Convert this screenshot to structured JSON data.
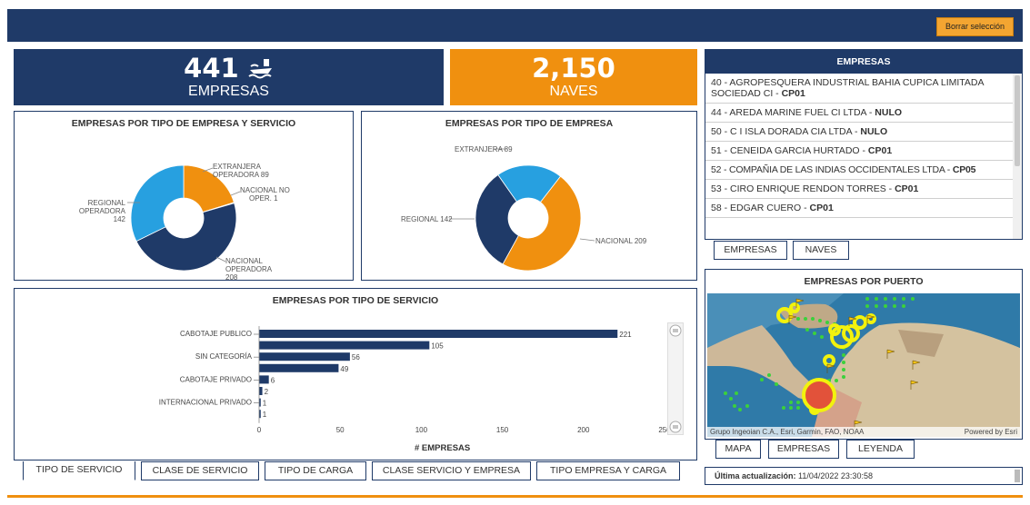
{
  "header": {
    "clear_selection_label": "Borrar selección"
  },
  "kpis": {
    "empresas": {
      "value": "441",
      "label": "EMPRESAS",
      "icon": "ship-icon"
    },
    "naves": {
      "value": "2,150",
      "label": "NAVES"
    }
  },
  "chart_servicio_tipo": {
    "title": "EMPRESAS POR TIPO DE EMPRESA Y SERVICIO",
    "labels": {
      "extranjera": [
        "EXTRANJERA",
        "OPERADORA 89"
      ],
      "nacional_no": [
        "NACIONAL NO",
        "OPER. 1"
      ],
      "regional": [
        "REGIONAL",
        "OPERADORA",
        "142"
      ],
      "nacional_op": [
        "NACIONAL",
        "OPERADORA",
        "208"
      ]
    }
  },
  "chart_tipo_empresa": {
    "title": "EMPRESAS POR TIPO DE EMPRESA",
    "labels": {
      "extranjera": "EXTRANJERA 89",
      "regional": "REGIONAL 142",
      "nacional": "NACIONAL 209"
    }
  },
  "chart_tipo_servicio": {
    "title": "EMPRESAS POR TIPO DE SERVICIO",
    "xlabel": "# EMPRESAS",
    "categories": [
      "CABOTAJE PUBLICO",
      "SIN CATEGORÍA",
      "CABOTAJE PRIVADO",
      "INTERNACIONAL PRIVADO"
    ],
    "ticks": [
      "0",
      "50",
      "100",
      "150",
      "200",
      "250"
    ]
  },
  "chart_data": [
    {
      "type": "pie",
      "title": "EMPRESAS POR TIPO DE EMPRESA Y SERVICIO",
      "labels": [
        "EXTRANJERA OPERADORA",
        "NACIONAL NO OPER.",
        "NACIONAL OPERADORA",
        "REGIONAL OPERADORA"
      ],
      "values": [
        89,
        1,
        208,
        142
      ]
    },
    {
      "type": "pie",
      "title": "EMPRESAS POR TIPO DE EMPRESA",
      "labels": [
        "EXTRANJERA",
        "NACIONAL",
        "REGIONAL"
      ],
      "values": [
        89,
        209,
        142
      ]
    },
    {
      "type": "bar",
      "title": "EMPRESAS POR TIPO DE SERVICIO",
      "xlabel": "# EMPRESAS",
      "xlim": [
        0,
        250
      ],
      "bars": [
        221,
        105,
        56,
        49,
        6,
        2,
        1,
        1
      ]
    }
  ],
  "empresas_panel": {
    "title": "EMPRESAS",
    "rows": [
      {
        "text": "40 - AGROPESQUERA INDUSTRIAL BAHIA CUPICA LIMITADA SOCIEDAD CI - ",
        "code": "CP01"
      },
      {
        "text": "44 - AREDA MARINE FUEL CI LTDA - ",
        "code": "NULO"
      },
      {
        "text": "50 - C I ISLA DORADA CIA LTDA - ",
        "code": "NULO"
      },
      {
        "text": "51 - CENEIDA GARCIA HURTADO - ",
        "code": "CP01"
      },
      {
        "text": "52 - COMPAÑIA DE LAS INDIAS OCCIDENTALES LTDA - ",
        "code": "CP05"
      },
      {
        "text": "53 - CIRO ENRIQUE RENDON TORRES - ",
        "code": "CP01"
      },
      {
        "text": "58 - EDGAR CUERO - ",
        "code": "CP01"
      }
    ],
    "tabs": [
      "EMPRESAS",
      "NAVES"
    ]
  },
  "map_panel": {
    "title": "EMPRESAS POR PUERTO",
    "attribution": "Grupo Ingeoian C.A., Esri, Garmin, FAO, NOAA",
    "powered": "Powered by Esri",
    "tabs": [
      "MAPA",
      "EMPRESAS",
      "LEYENDA"
    ]
  },
  "bottom_tabs": [
    "TIPO DE SERVICIO",
    "CLASE DE SERVICIO",
    "TIPO DE CARGA",
    "CLASE SERVICIO Y EMPRESA",
    "TIPO EMPRESA Y CARGA"
  ],
  "update": {
    "label": "Última actualización:",
    "value": "11/04/2022 23:30:58"
  },
  "colors": {
    "navy": "#1f3a68",
    "orange": "#f0900f",
    "lightblue": "#27a0e0"
  }
}
